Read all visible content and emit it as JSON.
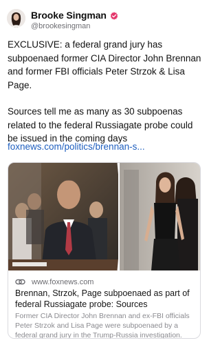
{
  "post": {
    "author": {
      "name": "Brooke Singman",
      "handle": "@brookesingman"
    },
    "body_paragraphs": [
      "EXCLUSIVE: a federal grand jury has subpoenaed former CIA Director John Brennan and former FBI officials Peter Strzok & Lisa Page.",
      "Sources tell me as many as 30 subpoenas related to the federal Russiagate probe could be issued in the coming days"
    ],
    "link_text": "foxnews.com/politics/brennan-s...",
    "card": {
      "domain": "www.foxnews.com",
      "title": "Brennan, Strzok, Page subpoenaed as part of federal Russiagate probe: Sources",
      "description": "Former CIA Director John Brennan and ex-FBI officials Peter Strzok and Lisa Page were subpoenaed by a federal grand jury in the Trump-Russia investigation."
    }
  },
  "icons": {
    "verified": "verified-badge-icon",
    "link": "link-icon"
  },
  "colors": {
    "link": "#1f5fbf",
    "verified_badge": "#e4366b",
    "muted_text": "#6e6e73"
  }
}
